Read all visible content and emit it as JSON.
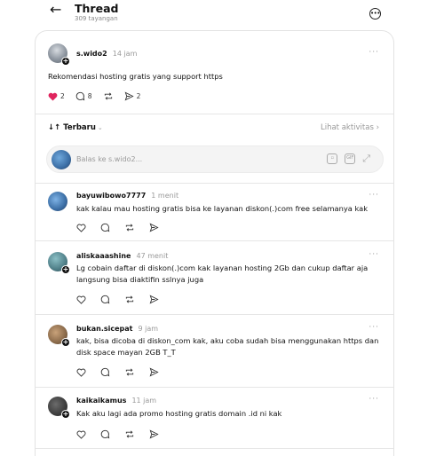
{
  "header": {
    "back_icon": "arrow-left-icon",
    "title": "Thread",
    "views": "309 tayangan",
    "more_icon": "more-circle-icon"
  },
  "main_post": {
    "username": "s.wido2",
    "time": "14 jam",
    "text": "Rekomendasi hosting gratis yang support https",
    "likes": "2",
    "replies": "8",
    "shares": "2",
    "like_color": "#e0245e"
  },
  "sort": {
    "label": "Terbaru",
    "activity_link": "Lihat aktivitas"
  },
  "reply_box": {
    "placeholder": "Balas ke s.wido2..."
  },
  "replies": [
    {
      "username": "bayuwibowo7777",
      "time": "1 menit",
      "text": "kak kalau mau hosting gratis bisa ke layanan diskon(.)com free selamanya kak"
    },
    {
      "username": "aliskaaashine",
      "time": "47 menit",
      "text": "Lg cobain daftar di diskon(.)com kak layanan hosting 2Gb dan cukup daftar aja langsung bisa diaktifin sslnya juga"
    },
    {
      "username": "bukan.sicepat",
      "time": "9 jam",
      "text": "kak, bisa dicoba di diskon_com kak, aku coba sudah bisa menggunakan https dan disk space mayan 2GB T_T"
    },
    {
      "username": "kaikaikamus",
      "time": "11 jam",
      "text": "Kak aku lagi ada promo hosting gratis domain .id ni kak"
    }
  ]
}
